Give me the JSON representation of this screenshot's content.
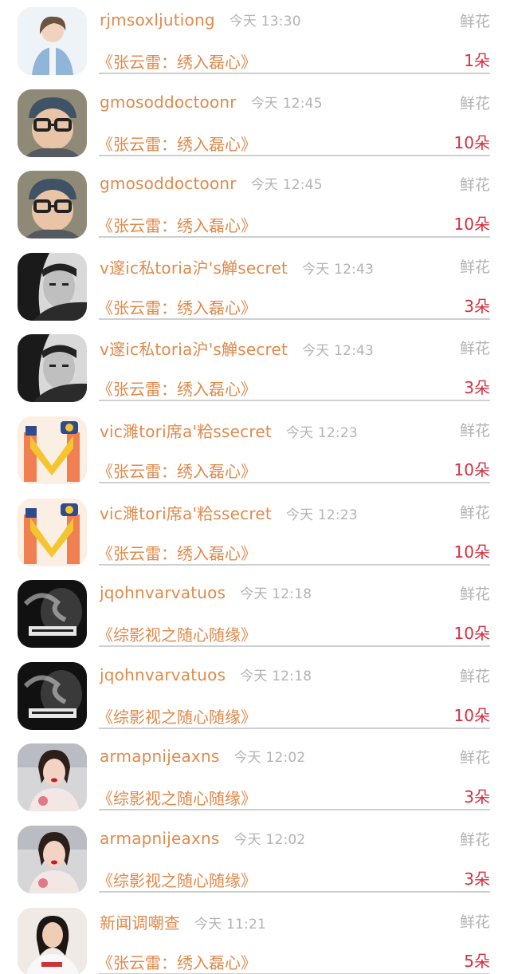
{
  "rows": [
    {
      "user": "rjmsoxljutiong",
      "time": "今天 13:30",
      "gift": "鲜花",
      "book": "《张云雷：绣入磊心》",
      "count": "1朵",
      "avatar": "girl-blue"
    },
    {
      "user": "gmosoddoctoonr",
      "time": "今天 12:45",
      "gift": "鲜花",
      "book": "《张云雷：绣入磊心》",
      "count": "10朵",
      "avatar": "boy-glasses"
    },
    {
      "user": "gmosoddoctoonr",
      "time": "今天 12:45",
      "gift": "鲜花",
      "book": "《张云雷：绣入磊心》",
      "count": "10朵",
      "avatar": "boy-glasses"
    },
    {
      "user": "v邃ic私toria沪's觯secret",
      "time": "今天 12:43",
      "gift": "鲜花",
      "book": "《张云雷：绣入磊心》",
      "count": "3朵",
      "avatar": "man-dark"
    },
    {
      "user": "v邃ic私toria沪's觯secret",
      "time": "今天 12:43",
      "gift": "鲜花",
      "book": "《张云雷：绣入磊心》",
      "count": "3朵",
      "avatar": "man-dark"
    },
    {
      "user": "vic濉tori席a'粭ssecret",
      "time": "今天 12:23",
      "gift": "鲜花",
      "book": "《张云雷：绣入磊心》",
      "count": "10朵",
      "avatar": "letter-m"
    },
    {
      "user": "vic濉tori席a'粭ssecret",
      "time": "今天 12:23",
      "gift": "鲜花",
      "book": "《张云雷：绣入磊心》",
      "count": "10朵",
      "avatar": "letter-m"
    },
    {
      "user": "jqohnvarvatuos",
      "time": "今天 12:18",
      "gift": "鲜花",
      "book": "《综影视之随心随缘》",
      "count": "10朵",
      "avatar": "bw-smoke"
    },
    {
      "user": "jqohnvarvatuos",
      "time": "今天 12:18",
      "gift": "鲜花",
      "book": "《综影视之随心随缘》",
      "count": "10朵",
      "avatar": "bw-smoke"
    },
    {
      "user": "armapnijeaxns",
      "time": "今天 12:02",
      "gift": "鲜花",
      "book": "《综影视之随心随缘》",
      "count": "3朵",
      "avatar": "woman-red"
    },
    {
      "user": "armapnijeaxns",
      "time": "今天 12:02",
      "gift": "鲜花",
      "book": "《综影视之随心随缘》",
      "count": "3朵",
      "avatar": "woman-red"
    },
    {
      "user": "新闻调嘲查",
      "time": "今天 11:21",
      "gift": "鲜花",
      "book": "《张云雷：绣入磊心》",
      "count": "5朵",
      "avatar": "woman-shirt"
    }
  ]
}
